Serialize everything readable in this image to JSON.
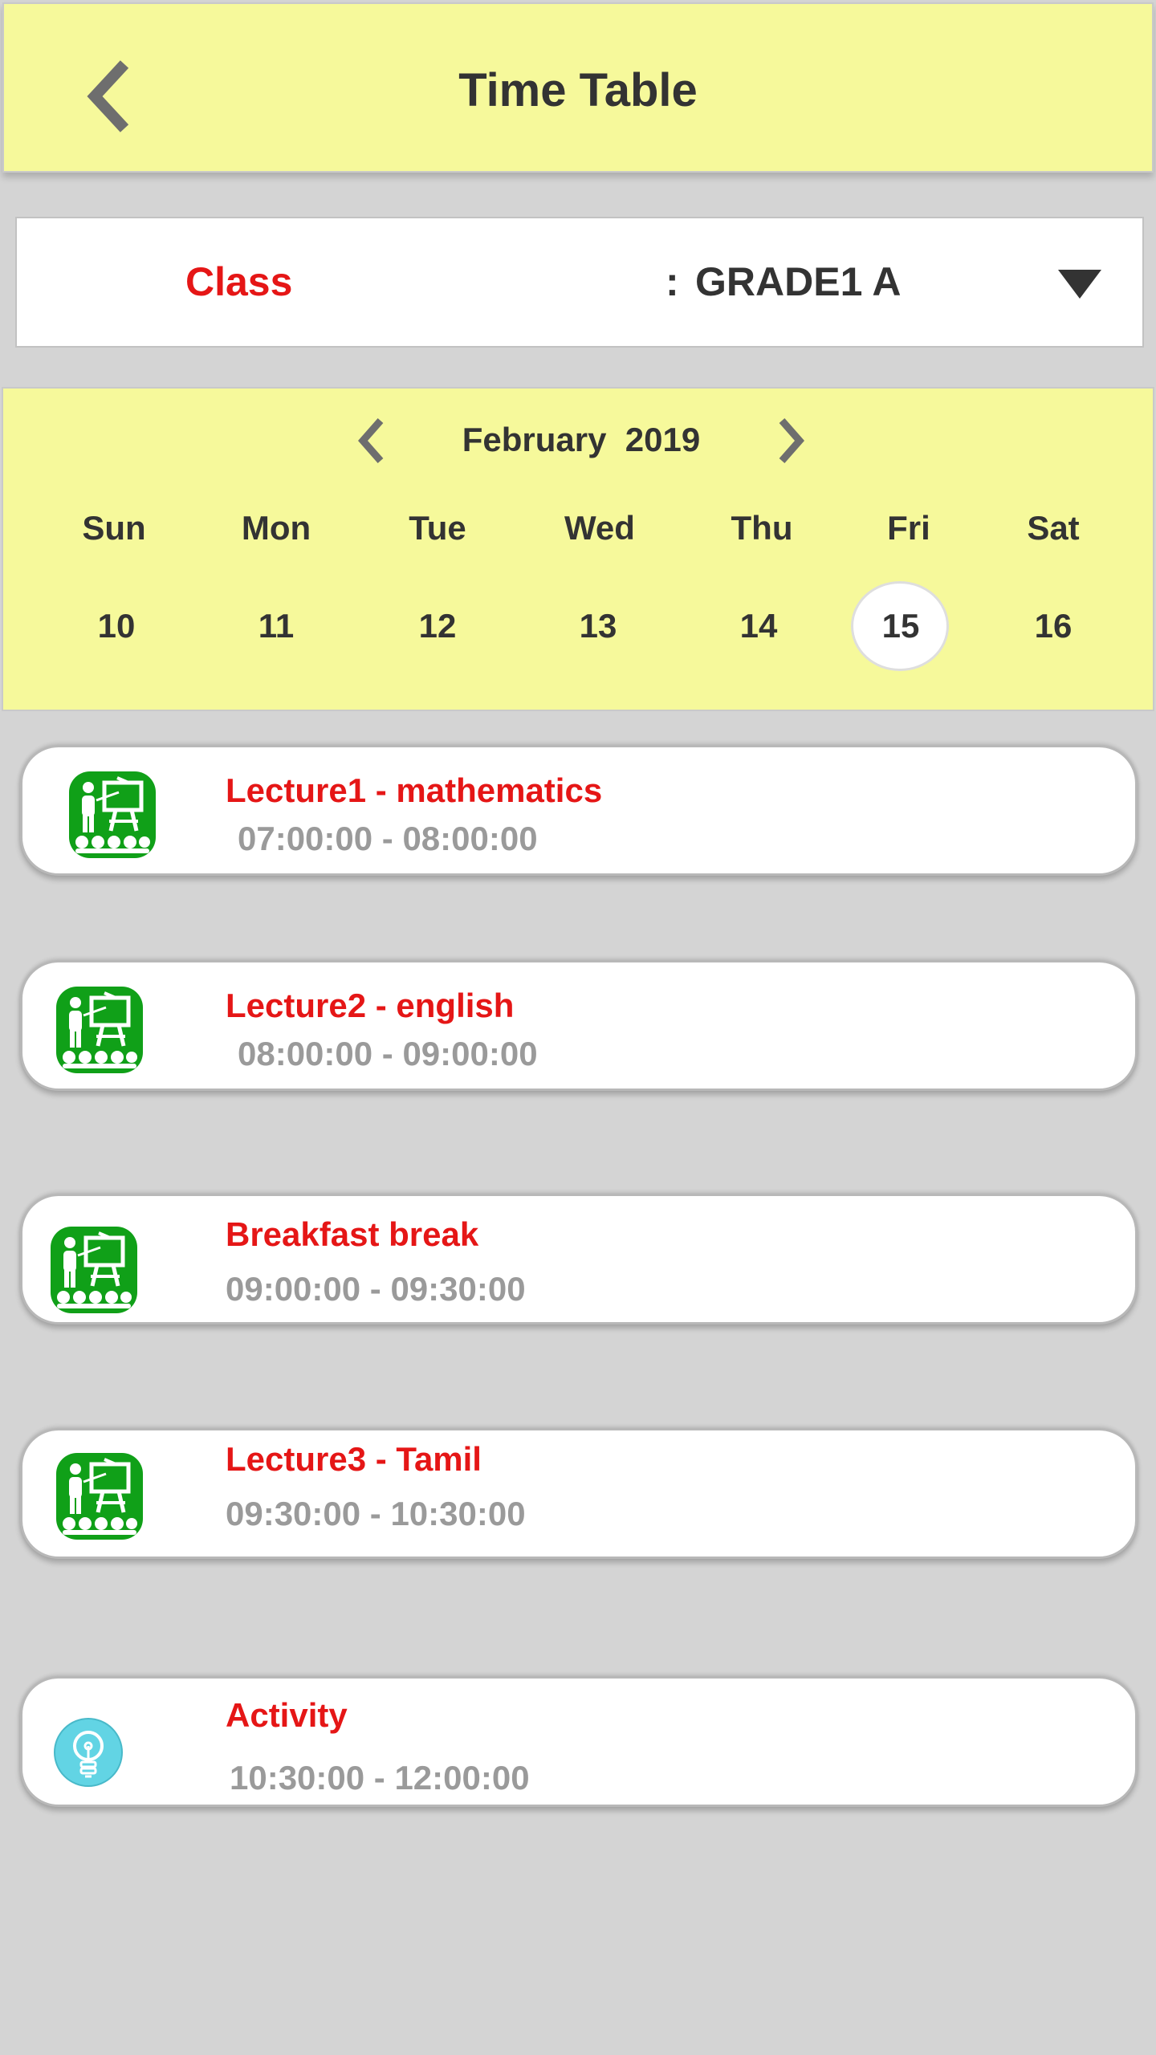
{
  "header": {
    "title": "Time Table",
    "back_icon": "chevron-left-icon"
  },
  "class_selector": {
    "label": "Class",
    "separator": ":",
    "value": "GRADE1 A",
    "dropdown_icon": "triangle-down-icon"
  },
  "calendar": {
    "month": "February",
    "year": "2019",
    "month_year": "February  2019",
    "prev_icon": "chevron-left-icon",
    "next_icon": "chevron-right-icon",
    "days": [
      {
        "dow": "Sun",
        "date": "10",
        "selected": false
      },
      {
        "dow": "Mon",
        "date": "11",
        "selected": false
      },
      {
        "dow": "Tue",
        "date": "12",
        "selected": false
      },
      {
        "dow": "Wed",
        "date": "13",
        "selected": false
      },
      {
        "dow": "Thu",
        "date": "14",
        "selected": false
      },
      {
        "dow": "Fri",
        "date": "15",
        "selected": true
      },
      {
        "dow": "Sat",
        "date": "16",
        "selected": false
      }
    ]
  },
  "schedule": [
    {
      "title": "Lecture1 - mathematics",
      "time": "07:00:00 - 08:00:00",
      "icon": "teacher-classroom-icon"
    },
    {
      "title": "Lecture2 - english",
      "time": "08:00:00 - 09:00:00",
      "icon": "teacher-classroom-icon"
    },
    {
      "title": "Breakfast break",
      "time": "09:00:00 - 09:30:00",
      "icon": "teacher-classroom-icon"
    },
    {
      "title": "Lecture3 - Tamil",
      "time": "09:30:00 - 10:30:00",
      "icon": "teacher-classroom-icon"
    },
    {
      "title": "Activity",
      "time": "10:30:00 - 12:00:00",
      "icon": "lightbulb-icon"
    }
  ],
  "colors": {
    "header_bg": "#f6f99b",
    "page_bg": "#d4d4d4",
    "accent_red": "#e51616",
    "icon_green": "#10a018",
    "icon_cyan": "#62d4e4",
    "time_grey": "#9a9a9a"
  }
}
